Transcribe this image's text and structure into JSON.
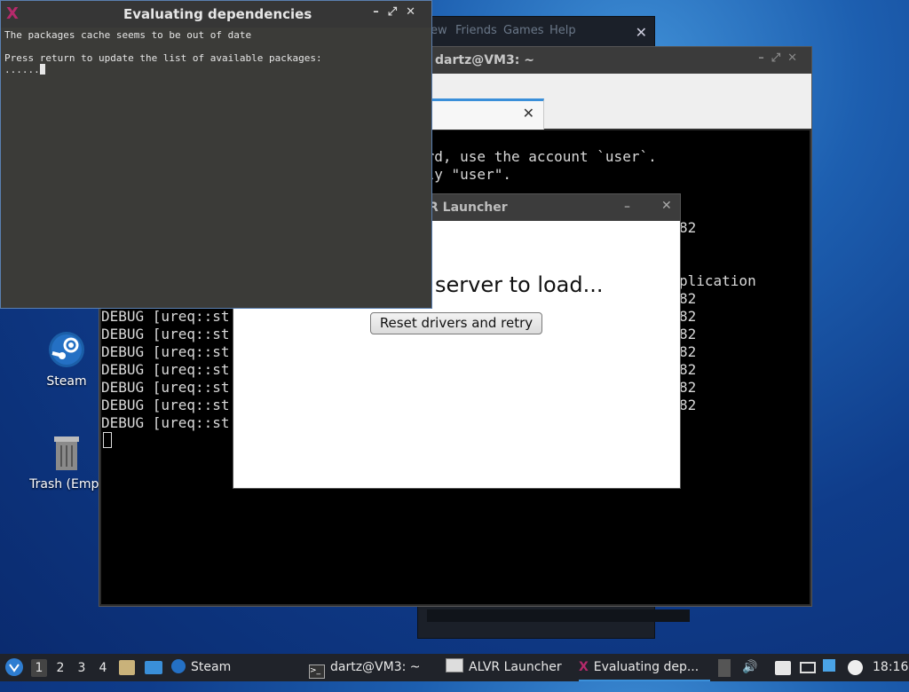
{
  "desktop": {
    "icons": [
      {
        "label": "Steam",
        "icon": "steam-icon"
      },
      {
        "label": "Trash (Empt",
        "icon": "trash-icon"
      }
    ]
  },
  "steam_window": {
    "menu": [
      "ew",
      "Friends",
      "Games",
      "Help"
    ]
  },
  "terminal": {
    "title": "dartz@VM3: ~",
    "lines": [
      "ord, use the account `user`.",
      "ply \"user\".",
      "82",
      "plication",
      "82",
      "82",
      "82",
      "82",
      "82",
      "82",
      "82"
    ],
    "debug_prefix": "DEBUG [ureq::st"
  },
  "alvr": {
    "title": "R Launcher",
    "message": "server to load...",
    "button": "Reset drivers and retry"
  },
  "deps": {
    "title": "Evaluating dependencies",
    "line1": "The packages cache seems to be out of date",
    "line2": "Press return to update the list of available packages:",
    "line3": "......"
  },
  "taskbar": {
    "workspaces": [
      "1",
      "2",
      "3",
      "4"
    ],
    "tasks": [
      "Steam",
      "dartz@VM3: ~",
      "ALVR Launcher",
      "Evaluating dep..."
    ],
    "clock": "18:16"
  },
  "colors": {
    "accent": "#3a8fd9",
    "taskbar": "#20232a"
  }
}
